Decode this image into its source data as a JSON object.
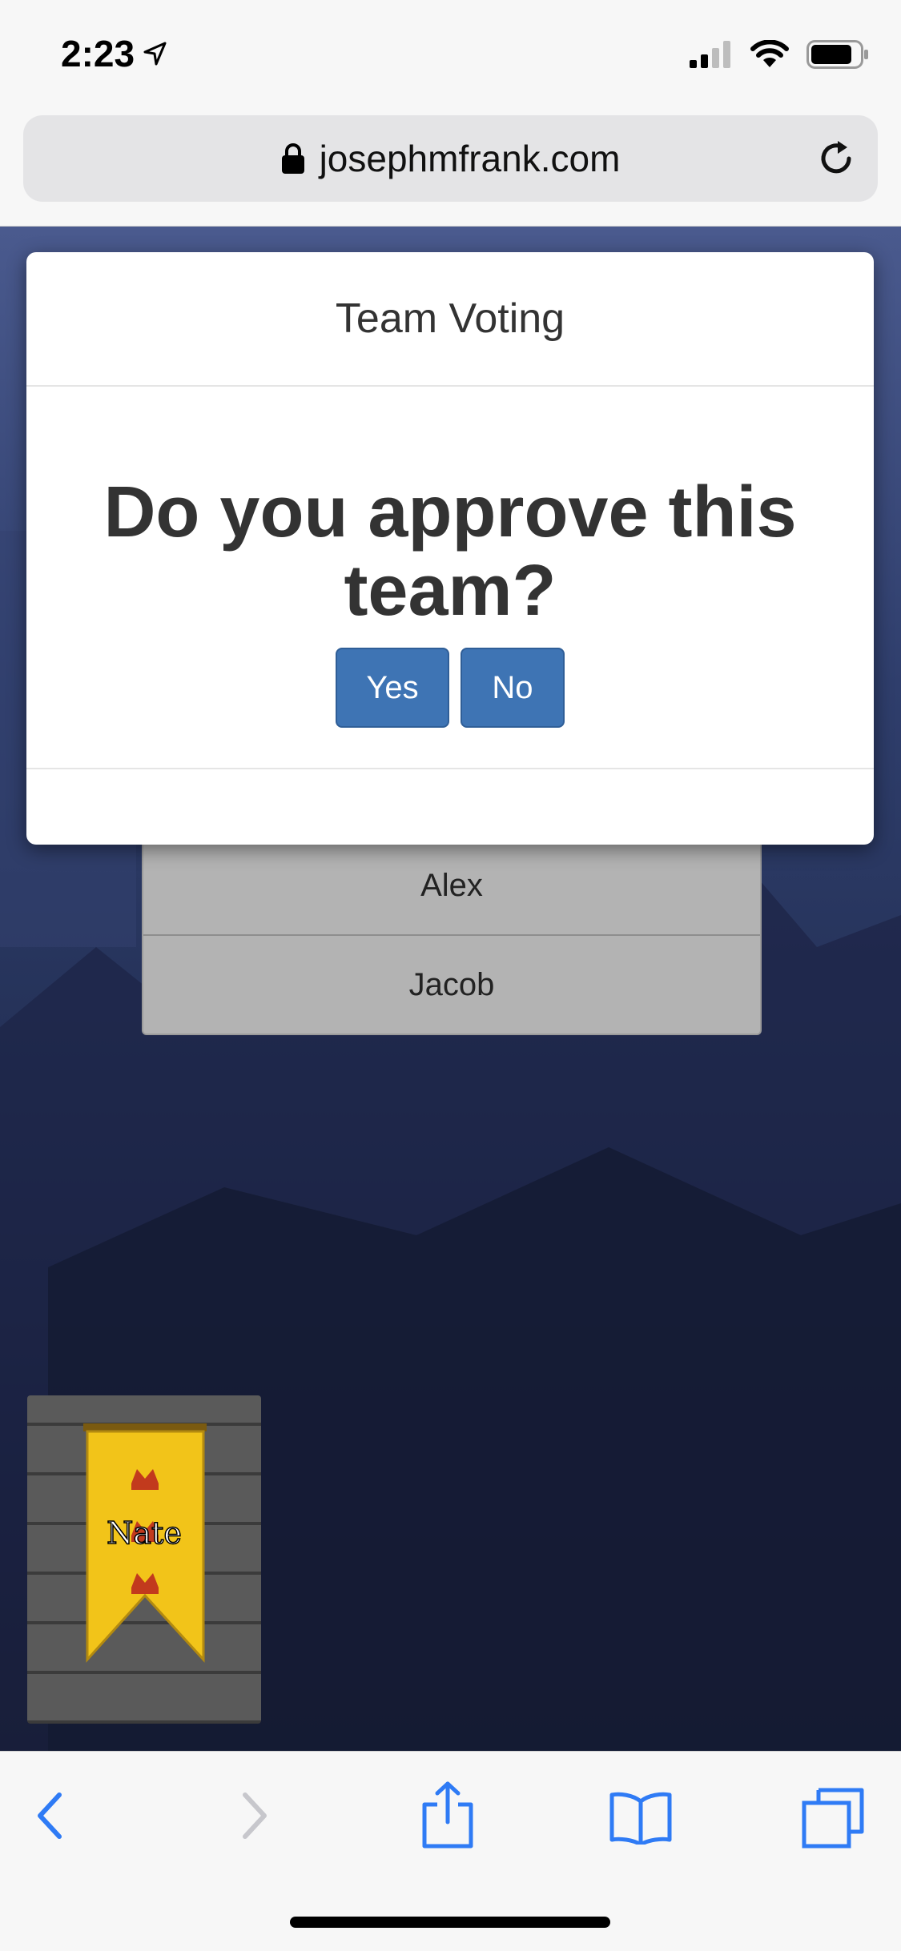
{
  "status_bar": {
    "time": "2:23",
    "icons": [
      "location-arrow-icon",
      "signal-icon",
      "wifi-icon",
      "battery-icon"
    ]
  },
  "browser": {
    "url": "josephmfrank.com",
    "icons": [
      "lock-icon",
      "reload-icon"
    ]
  },
  "modal": {
    "title": "Team Voting",
    "question": "Do you approve this team?",
    "yes_label": "Yes",
    "no_label": "No"
  },
  "team": {
    "players": [
      "Alex",
      "Jacob"
    ]
  },
  "player_card": {
    "name": "Nate"
  },
  "toolbar": {
    "icons": [
      "back-icon",
      "forward-icon",
      "share-icon",
      "bookmarks-icon",
      "tabs-icon"
    ]
  },
  "colors": {
    "accent": "#3e74b4",
    "browser_link": "#2f7bf5",
    "banner_yellow": "#f2c419",
    "banner_crown": "#c23a1d"
  }
}
